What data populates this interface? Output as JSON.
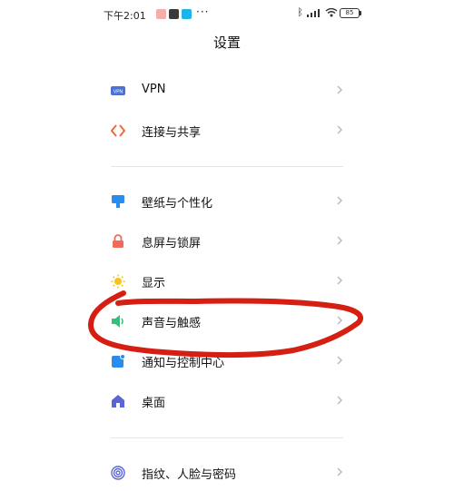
{
  "status_bar": {
    "time": "下午2:01",
    "more": "···",
    "battery": "85"
  },
  "page": {
    "title": "设置"
  },
  "settings": {
    "items": [
      {
        "label": "VPN",
        "icon": "vpn-icon",
        "color": "#4a72d9"
      },
      {
        "label": "连接与共享",
        "icon": "connection-share-icon",
        "color": "#ef6a3d"
      },
      {
        "label": "壁纸与个性化",
        "icon": "wallpaper-personalization-icon",
        "color": "#2b8cf0"
      },
      {
        "label": "息屏与锁屏",
        "icon": "lock-screen-icon",
        "color": "#f06b57"
      },
      {
        "label": "显示",
        "icon": "display-sun-icon",
        "color": "#f7c31a"
      },
      {
        "label": "声音与触感",
        "icon": "sound-icon",
        "color": "#33c07a"
      },
      {
        "label": "通知与控制中心",
        "icon": "notification-icon",
        "color": "#2b8cf0"
      },
      {
        "label": "桌面",
        "icon": "home-icon",
        "color": "#5a66d6"
      },
      {
        "label": "指纹、人脸与密码",
        "icon": "fingerprint-icon",
        "color": "#5a66d6"
      }
    ]
  },
  "annotation": {
    "color": "#d51f12",
    "description": "hand-drawn-circle-around-sound-item"
  }
}
